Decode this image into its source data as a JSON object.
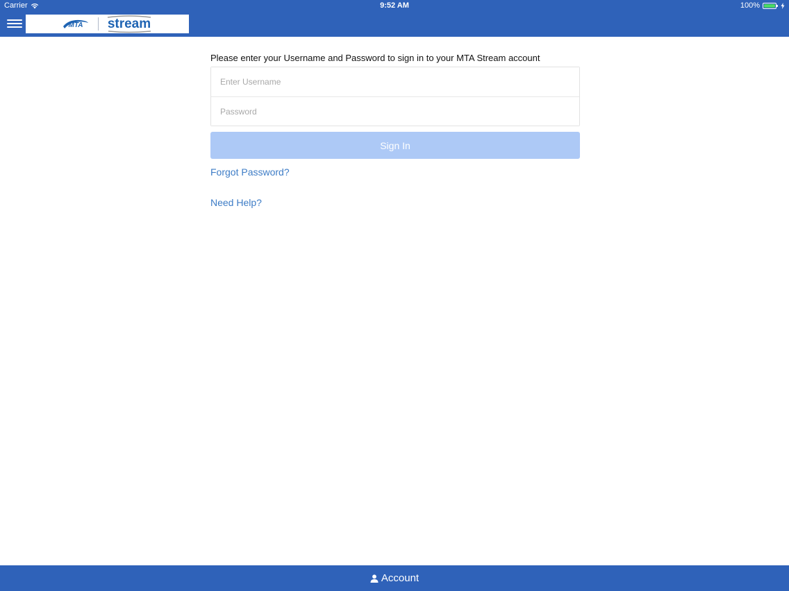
{
  "status_bar": {
    "carrier": "Carrier",
    "time": "9:52 AM",
    "battery": "100%",
    "wifi_icon": "wifi-icon",
    "battery_icon": "battery-icon",
    "charging_icon": "charging-icon"
  },
  "header": {
    "menu_icon": "hamburger-menu-icon",
    "logo": {
      "mta_text": "MTA",
      "stream_text": "stream"
    },
    "brand_color": "#2f62b9"
  },
  "login": {
    "prompt": "Please enter your Username and Password to sign in to your MTA Stream account",
    "username": {
      "value": "",
      "placeholder": "Enter Username"
    },
    "password": {
      "value": "",
      "placeholder": "Password"
    },
    "signin_label": "Sign In",
    "signin_color": "#adc9f6",
    "forgot_label": "Forgot Password?",
    "help_label": "Need Help?",
    "link_color": "#3d7cc6"
  },
  "footer": {
    "tab_label": "Account",
    "tab_icon": "person-icon"
  }
}
